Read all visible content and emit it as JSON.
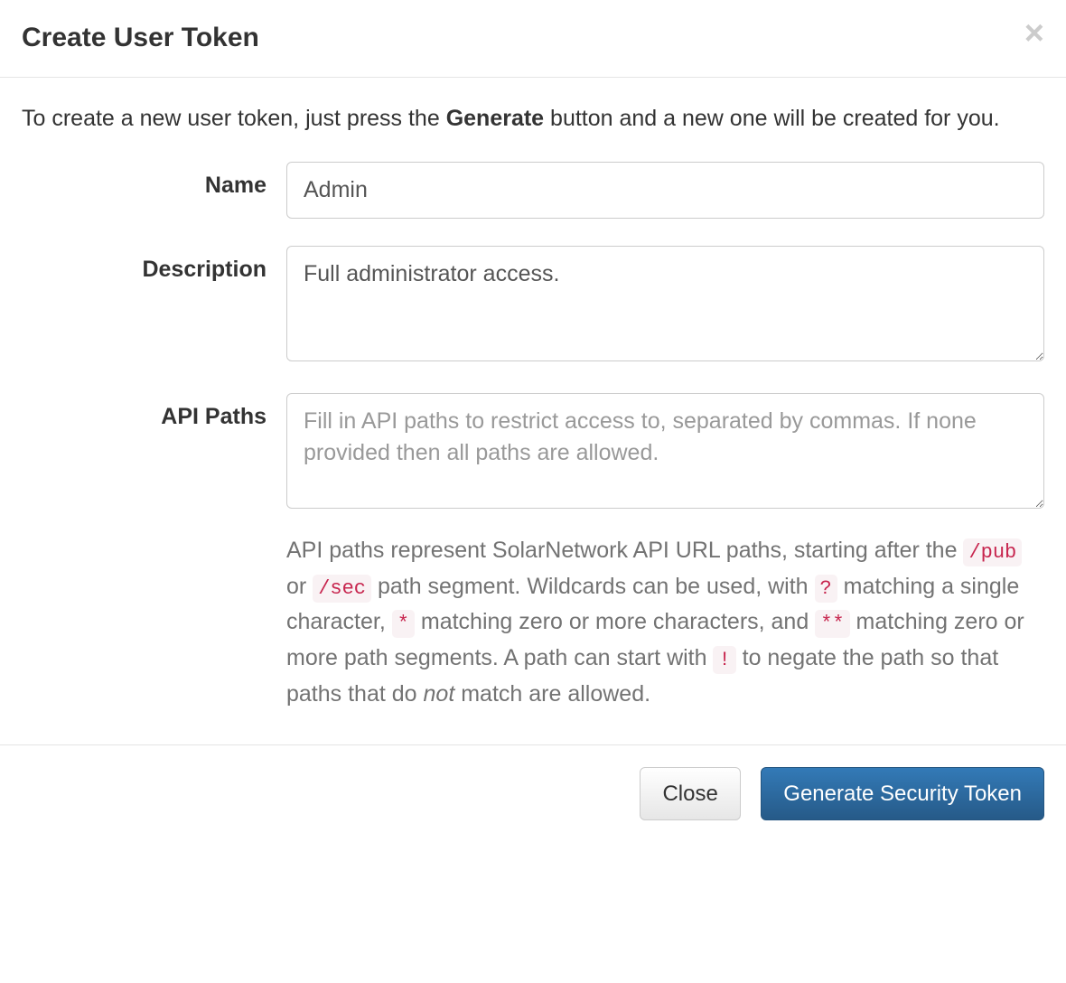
{
  "modal": {
    "title": "Create User Token",
    "intro": {
      "before": "To create a new user token, just press the ",
      "bold": "Generate",
      "after": " button and a new one will be created for you."
    },
    "form": {
      "name": {
        "label": "Name",
        "value": "Admin"
      },
      "description": {
        "label": "Description",
        "value": "Full administrator access."
      },
      "apiPaths": {
        "label": "API Paths",
        "placeholder": "Fill in API paths to restrict access to, separated by commas. If none provided then all paths are allowed.",
        "help": {
          "t1": "API paths represent SolarNetwork API URL paths, starting after the ",
          "c1": "/pub",
          "t2": " or ",
          "c2": "/sec",
          "t3": " path segment. Wildcards can be used, with ",
          "c3": "?",
          "t4": " matching a single character, ",
          "c4": "*",
          "t5": " matching zero or more characters, and ",
          "c5": "**",
          "t6": " matching zero or more path segments. A path can start with ",
          "c6": "!",
          "t7": " to negate the path so that paths that do ",
          "em": "not",
          "t8": " match are allowed."
        }
      }
    },
    "footer": {
      "closeLabel": "Close",
      "generateLabel": "Generate Security Token"
    }
  }
}
